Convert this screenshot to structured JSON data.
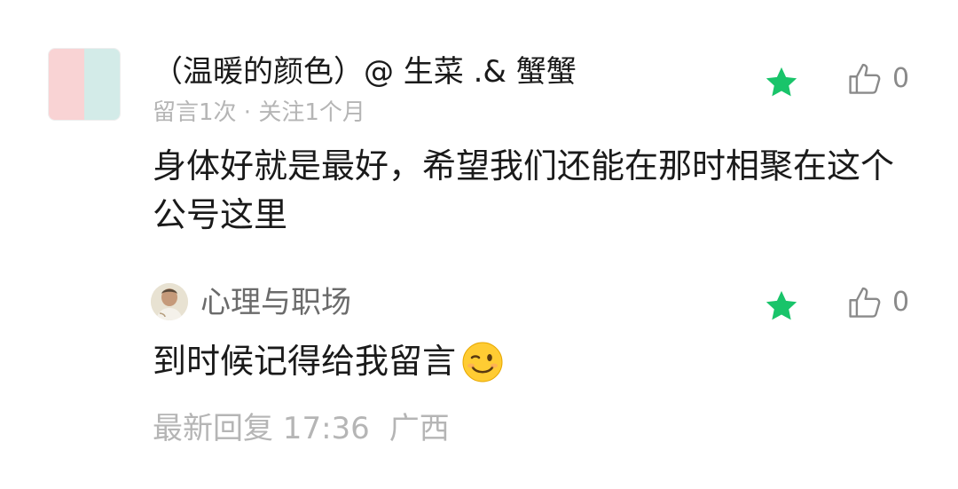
{
  "comment": {
    "author": "（温暖的颜色）@ 生菜 .& 蟹蟹",
    "meta": "留言1次 · 关注1个月",
    "text": "身体好就是最好，希望我们还能在那时相聚在这个公号这里",
    "like_count": "0",
    "avatar": {
      "colors": [
        "#f9d3d4",
        "#d3ebe8"
      ]
    },
    "star_icon": "star-icon",
    "like_icon": "thumbs-up-icon"
  },
  "reply": {
    "author": "心理与职场",
    "text": "到时候记得给我留言",
    "emoji": "winking-face-emoji",
    "like_count": "0",
    "time": "最新回复 17:36",
    "location": "广西",
    "star_icon": "star-icon",
    "like_icon": "thumbs-up-icon"
  },
  "colors": {
    "star": "#19c46a",
    "text_primary": "#1a1a1a",
    "text_secondary": "#b5b5b5",
    "text_reply_author": "#6b6b6b",
    "like_icon": "#8a8a8a"
  }
}
